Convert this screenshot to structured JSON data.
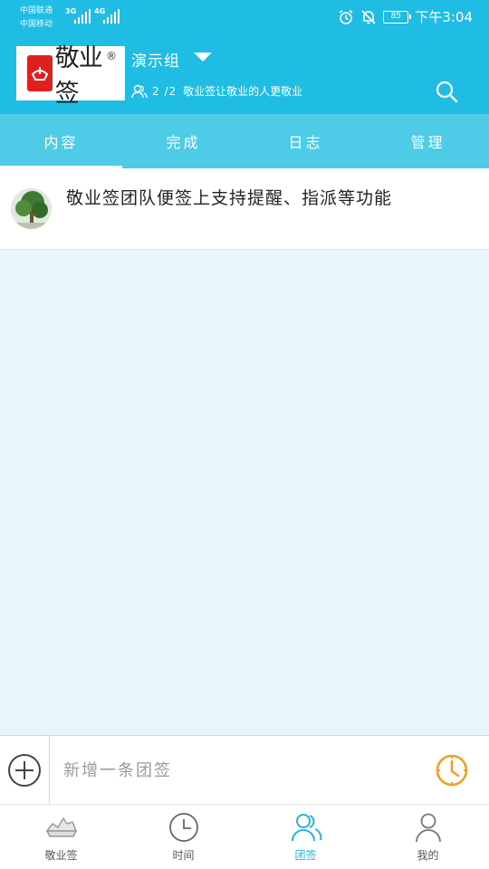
{
  "status_bar": {
    "carrier_1": "中国联通",
    "carrier_2": "中国移动",
    "net_1": "3G",
    "net_2": "4G",
    "battery": "85",
    "time": "下午3:04"
  },
  "header": {
    "logo_text": "敬业签",
    "logo_reg": "®",
    "group_name": "演示组",
    "member_count": "2 /2",
    "slogan": "敬业签让敬业的人更敬业"
  },
  "tabs": [
    {
      "label": "内容",
      "active": true
    },
    {
      "label": "完成",
      "active": false
    },
    {
      "label": "日志",
      "active": false
    },
    {
      "label": "管理",
      "active": false
    }
  ],
  "notes": [
    {
      "text": "敬业签团队便签上支持提醒、指派等功能"
    }
  ],
  "input_bar": {
    "placeholder": "新增一条团签"
  },
  "bottom_nav": [
    {
      "label": "敬业签",
      "icon": "boat-icon",
      "active": false
    },
    {
      "label": "时间",
      "icon": "clock-icon",
      "active": false
    },
    {
      "label": "团签",
      "icon": "group-icon",
      "active": true
    },
    {
      "label": "我的",
      "icon": "user-icon",
      "active": false
    }
  ],
  "colors": {
    "header_bg": "#1fbde4",
    "tabs_bg": "#4ecbe7",
    "content_bg": "#e6f6fb",
    "accent_orange": "#f0a020",
    "nav_active": "#28b4dc"
  }
}
